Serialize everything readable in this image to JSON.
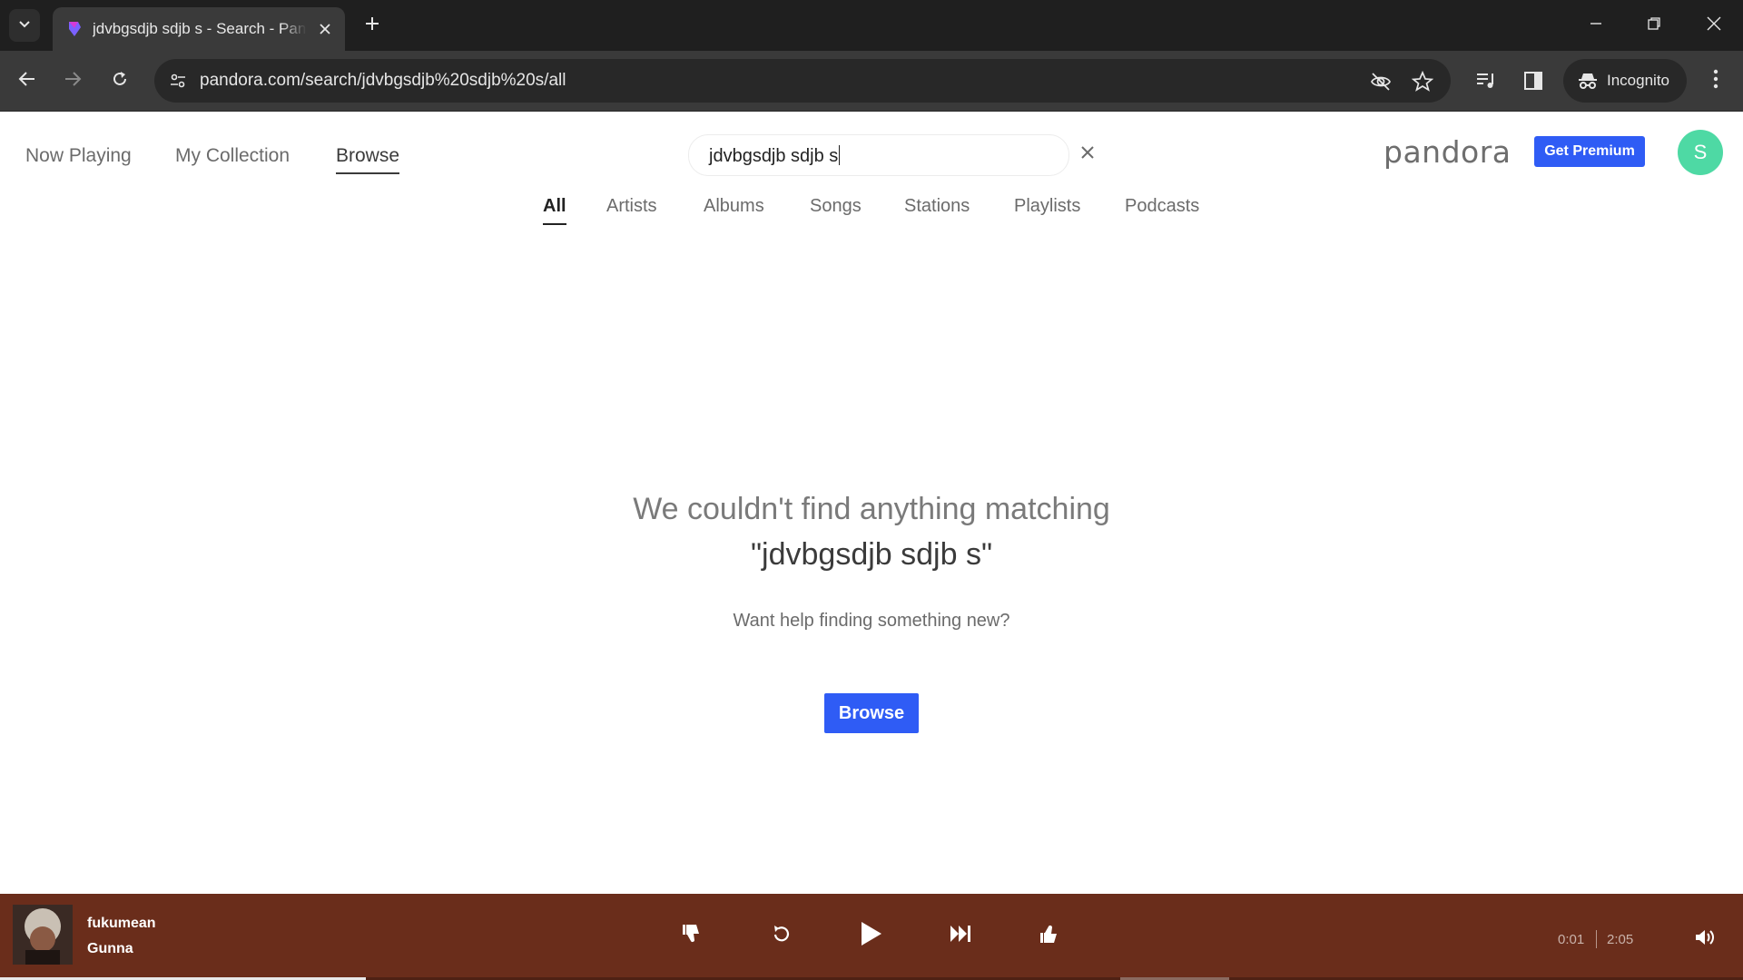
{
  "browser": {
    "tab_title": "jdvbgsdjb sdjb s - Search - Pandora",
    "url": "pandora.com/search/jdvbgsdjb%20sdjb%20s/all",
    "incognito_label": "Incognito"
  },
  "nav": {
    "now_playing": "Now Playing",
    "my_collection": "My Collection",
    "browse": "Browse"
  },
  "search": {
    "value": "jdvbgsdjb sdjb s"
  },
  "brand": {
    "logo": "pandora",
    "premium_label": "Get Premium",
    "avatar_initial": "S",
    "accent_color": "#2f5cf5",
    "avatar_color": "#4ed9a4"
  },
  "filters": [
    "All",
    "Artists",
    "Albums",
    "Songs",
    "Stations",
    "Playlists",
    "Podcasts"
  ],
  "empty_state": {
    "line1": "We couldn't find anything matching",
    "query_quoted": "\"jdvbgsdjb sdjb s\"",
    "help": "Want help finding something new?",
    "browse_label": "Browse"
  },
  "player": {
    "title": "fukumean",
    "artist": "Gunna",
    "elapsed": "0:01",
    "duration": "2:05",
    "progress_fraction": 0.21,
    "bar_color": "#6a2d1b",
    "icons": [
      "thumbs-down-icon",
      "replay-icon",
      "play-icon",
      "skip-forward-icon",
      "thumbs-up-icon",
      "volume-icon"
    ]
  }
}
